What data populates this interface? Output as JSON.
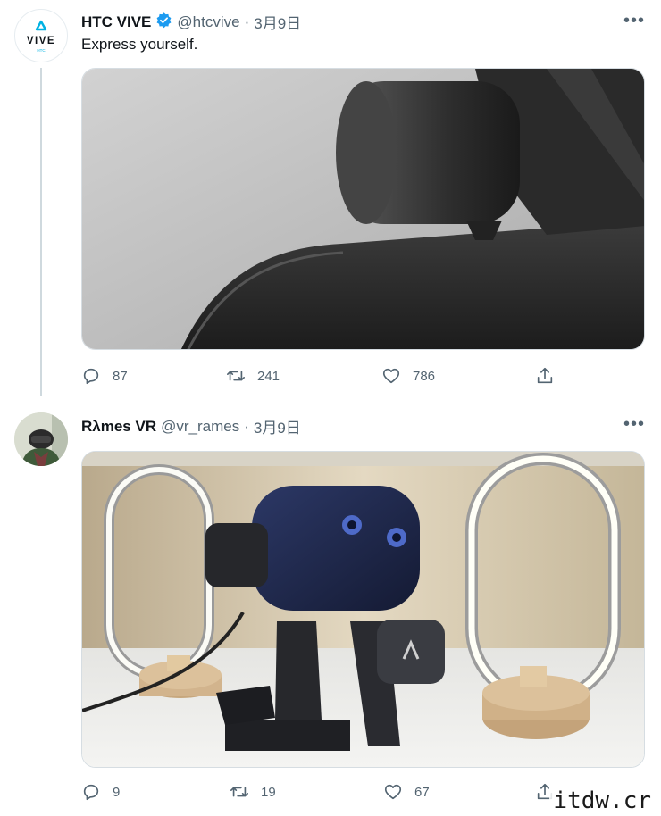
{
  "tweets": [
    {
      "name": "HTC VIVE",
      "handle": "@htcvive",
      "separator": "·",
      "date": "3月9日",
      "text": "Express yourself.",
      "avatar_text": "VIVE",
      "avatar_subtext": "HTC",
      "verified": true,
      "more_label": "•••",
      "stats": {
        "replies": "87",
        "retweets": "241",
        "likes": "786"
      }
    },
    {
      "name": "Rλmes VR",
      "handle": "@vr_rames",
      "separator": "·",
      "date": "3月9日",
      "more_label": "•••",
      "stats": {
        "replies": "9",
        "retweets": "19",
        "likes": "67"
      }
    }
  ],
  "watermark": "itdw.cr",
  "colors": {
    "verified": "#1d9bf0",
    "muted": "#536471",
    "vive_logo": "#00b2e3"
  }
}
